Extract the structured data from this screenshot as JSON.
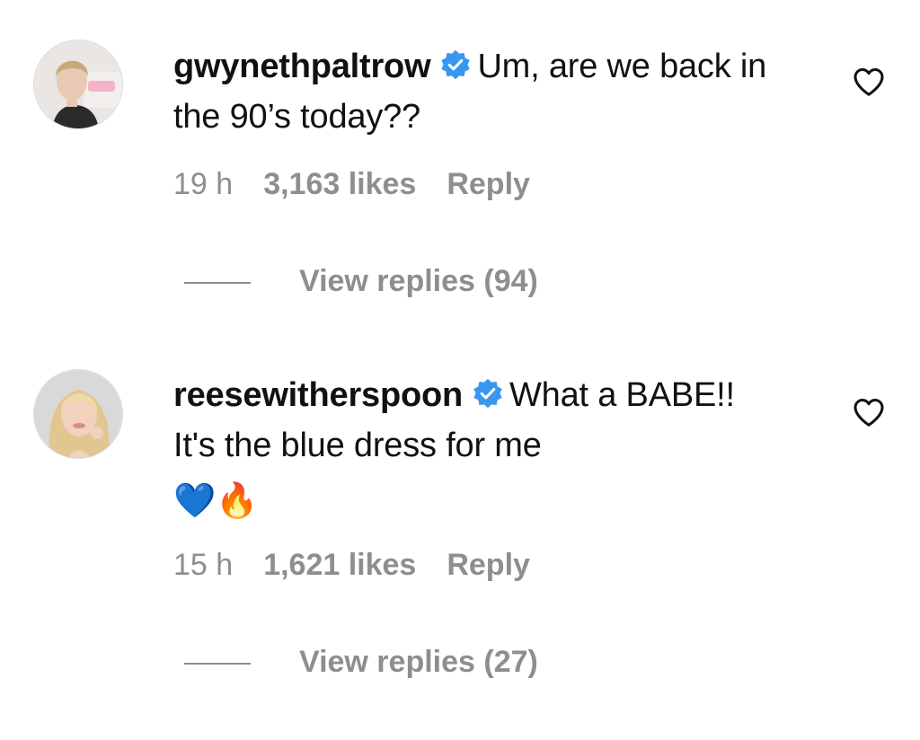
{
  "comments": [
    {
      "username": "gwynethpaltrow",
      "verified": true,
      "text": "Um, are we back in the 90’s today??",
      "emoji": "",
      "time": "19 h",
      "likes": "3,163 likes",
      "reply_label": "Reply",
      "view_replies": "View replies (94)",
      "avatar_icon": "avatar-photo-icon"
    },
    {
      "username": "reesewitherspoon",
      "verified": true,
      "text": "What a BABE!! It's the blue dress for me",
      "emoji": "💙🔥",
      "time": "15 h",
      "likes": "1,621 likes",
      "reply_label": "Reply",
      "view_replies": "View replies (27)",
      "avatar_icon": "avatar-photo-icon"
    }
  ],
  "colors": {
    "verified_badge": "#3897f0",
    "meta_gray": "#8e8e8e",
    "text": "#111111"
  }
}
